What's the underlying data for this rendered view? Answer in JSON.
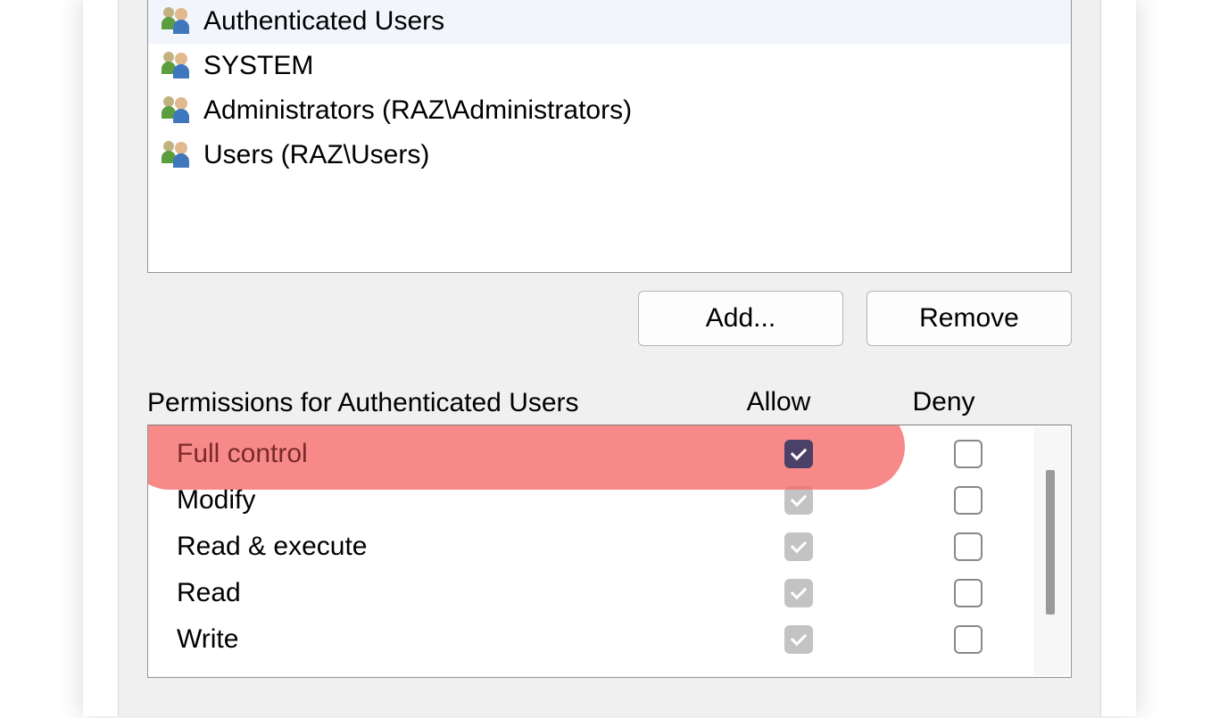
{
  "groups": [
    {
      "label": "Authenticated Users",
      "selected": true
    },
    {
      "label": "SYSTEM",
      "selected": false
    },
    {
      "label": "Administrators (RAZ\\Administrators)",
      "selected": false
    },
    {
      "label": "Users (RAZ\\Users)",
      "selected": false
    }
  ],
  "buttons": {
    "add": "Add...",
    "remove": "Remove"
  },
  "permHeader": {
    "label": "Permissions for Authenticated Users",
    "allow": "Allow",
    "deny": "Deny"
  },
  "permissions": [
    {
      "label": "Full control",
      "allow": "checked-dark",
      "deny": "unchecked",
      "highlighted": true
    },
    {
      "label": "Modify",
      "allow": "checked-grey",
      "deny": "unchecked"
    },
    {
      "label": "Read & execute",
      "allow": "checked-grey",
      "deny": "unchecked"
    },
    {
      "label": "Read",
      "allow": "checked-grey",
      "deny": "unchecked"
    },
    {
      "label": "Write",
      "allow": "checked-grey",
      "deny": "unchecked"
    }
  ]
}
